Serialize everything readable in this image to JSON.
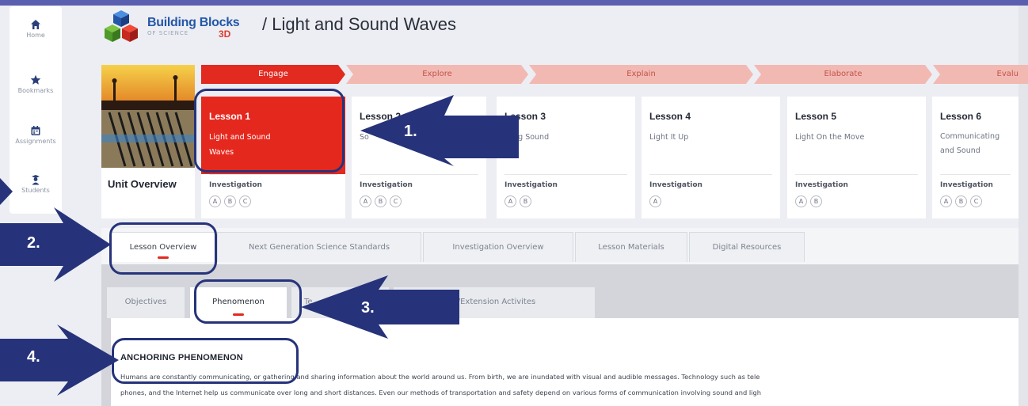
{
  "sidebar": {
    "items": [
      {
        "label": "Home",
        "icon": "home-icon"
      },
      {
        "label": "Bookmarks",
        "icon": "star-icon"
      },
      {
        "label": "Assignments",
        "icon": "calendar-icon"
      },
      {
        "label": "Students",
        "icon": "students-icon"
      }
    ]
  },
  "header": {
    "brand_main": "Building Blocks",
    "brand_sub": "OF SCIENCE",
    "brand_3d": "3D",
    "title": "/ Light and Sound Waves"
  },
  "phases": [
    "Engage",
    "Explore",
    "Explain",
    "Elaborate",
    "Evalu"
  ],
  "unit": {
    "label": "Unit Overview"
  },
  "lessons": [
    {
      "title": "Lesson 1",
      "name": "Light and Sound Waves",
      "investigation_label": "Investigation",
      "investigations": [
        "A",
        "B",
        "C"
      ],
      "active": true
    },
    {
      "title": "Lesson 2",
      "name": "So",
      "investigation_label": "Investigation",
      "investigations": [
        "A",
        "B",
        "C"
      ]
    },
    {
      "title": "Lesson 3",
      "name": "eling Sound",
      "investigation_label": "Investigation",
      "investigations": [
        "A",
        "B"
      ]
    },
    {
      "title": "Lesson 4",
      "name": "Light It Up",
      "investigation_label": "Investigation",
      "investigations": [
        "A"
      ]
    },
    {
      "title": "Lesson 5",
      "name": "Light On the Move",
      "investigation_label": "Investigation",
      "investigations": [
        "A",
        "B"
      ]
    },
    {
      "title": "Lesson 6",
      "name": "Communicating and Sound",
      "investigation_label": "Investigation",
      "investigations": [
        "A",
        "B",
        "C"
      ]
    }
  ],
  "tabs": [
    "Lesson Overview",
    "Next Generation Science Standards",
    "Investigation Overview",
    "Lesson Materials",
    "Digital Resources"
  ],
  "subtabs": [
    "Objectives",
    "Phenomenon",
    "Te",
    "y/Extension Activites"
  ],
  "content": {
    "heading": "ANCHORING PHENOMENON",
    "para1": "Humans are constantly communicating, or gathering and sharing information about the world around us. From birth, we are inundated with visual and audible messages. Technology such as tele",
    "para2": "phones, and the Internet help us communicate over long and short distances. Even our methods of transportation and safety depend on various forms of communication involving sound and ligh"
  },
  "callouts": [
    "1.",
    "2.",
    "3.",
    "4."
  ],
  "colors": {
    "accent": "#e22a20",
    "annotation": "#26337a",
    "brand": "#2456a8"
  }
}
